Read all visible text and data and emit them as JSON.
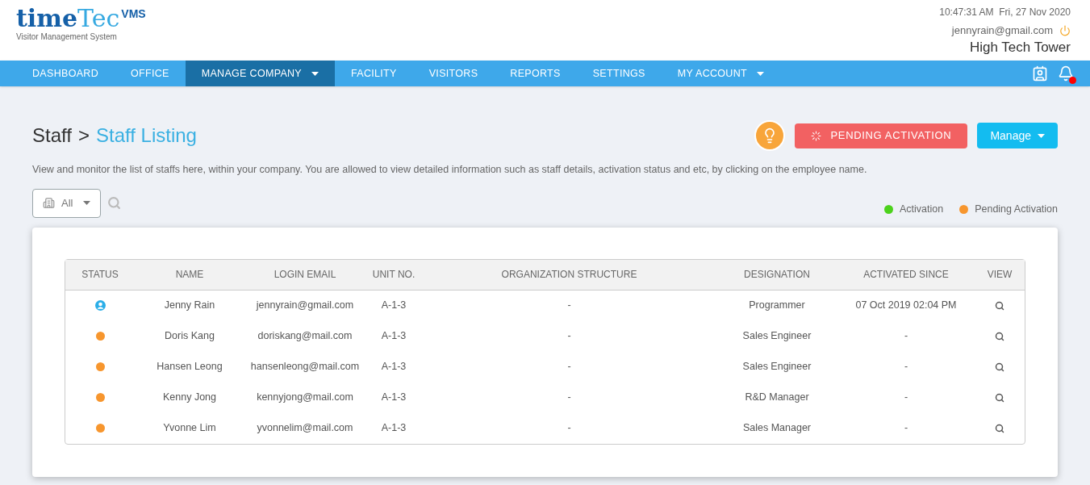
{
  "logo": {
    "word_1": "time",
    "word_2": "Tec",
    "badge": "VMS",
    "tagline": "Visitor Management System"
  },
  "header": {
    "clock": "10:47:31 AM  Fri, 27 Nov 2020",
    "email": "jennyrain@gmail.com",
    "site": "High Tech Tower"
  },
  "nav": [
    {
      "label": "DASHBOARD",
      "selected": false,
      "dropdown": false
    },
    {
      "label": "OFFICE",
      "selected": false,
      "dropdown": false
    },
    {
      "label": "MANAGE COMPANY",
      "selected": true,
      "dropdown": true
    },
    {
      "label": "FACILITY",
      "selected": false,
      "dropdown": false
    },
    {
      "label": "VISITORS",
      "selected": false,
      "dropdown": false
    },
    {
      "label": "REPORTS",
      "selected": false,
      "dropdown": false
    },
    {
      "label": "SETTINGS",
      "selected": false,
      "dropdown": false
    },
    {
      "label": "MY ACCOUNT",
      "selected": false,
      "dropdown": true
    }
  ],
  "breadcrumb": {
    "parent": "Staff",
    "separator": ">",
    "current": "Staff Listing"
  },
  "actions": {
    "pending_button": "PENDING ACTIVATION",
    "manage_button": "Manage"
  },
  "description": "View and monitor the list of staffs here, within your company. You are allowed to view detailed information such as staff details, activation status and etc, by clicking on the employee name.",
  "filter": {
    "value": "All"
  },
  "legend": [
    {
      "label": "Activation",
      "color": "#4cd21c"
    },
    {
      "label": "Pending Activation",
      "color": "#f7962e"
    }
  ],
  "table": {
    "columns": [
      "STATUS",
      "NAME",
      "LOGIN EMAIL",
      "UNIT NO.",
      "ORGANIZATION STRUCTURE",
      "DESIGNATION",
      "ACTIVATED SINCE",
      "VIEW"
    ],
    "rows": [
      {
        "status": {
          "kind": "self",
          "color": "#2aaee8"
        },
        "name": "Jenny Rain",
        "email": "jennyrain@gmail.com",
        "unit": "A-1-3",
        "org": "-",
        "designation": "Programmer",
        "activated": "07 Oct 2019 02:04 PM"
      },
      {
        "status": {
          "kind": "dot",
          "color": "#f7962e"
        },
        "name": "Doris Kang",
        "email": "doriskang@mail.com",
        "unit": "A-1-3",
        "org": "-",
        "designation": "Sales Engineer",
        "activated": "-"
      },
      {
        "status": {
          "kind": "dot",
          "color": "#f7962e"
        },
        "name": "Hansen Leong",
        "email": "hansenleong@mail.com",
        "unit": "A-1-3",
        "org": "-",
        "designation": "Sales Engineer",
        "activated": "-"
      },
      {
        "status": {
          "kind": "dot",
          "color": "#f7962e"
        },
        "name": "Kenny Jong",
        "email": "kennyjong@mail.com",
        "unit": "A-1-3",
        "org": "-",
        "designation": "R&D Manager",
        "activated": "-"
      },
      {
        "status": {
          "kind": "dot",
          "color": "#f7962e"
        },
        "name": "Yvonne Lim",
        "email": "yvonnelim@mail.com",
        "unit": "A-1-3",
        "org": "-",
        "designation": "Sales Manager",
        "activated": "-"
      }
    ]
  }
}
